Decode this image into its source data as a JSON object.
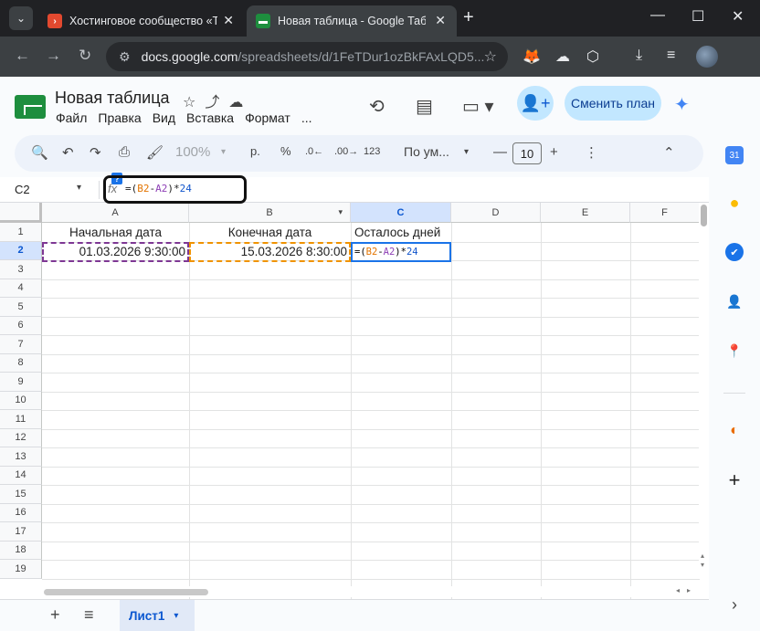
{
  "browser": {
    "tab_menu_glyph": "⌄",
    "tabs": [
      {
        "title": "Хостинговое сообщество «Tim",
        "favicon_color": "#e2492f",
        "favicon_glyph": "›",
        "close": "✕"
      },
      {
        "title": "Новая таблица - Google Табли",
        "favicon_color": "#1e8e3e",
        "favicon_glyph": "▬",
        "close": "✕"
      }
    ],
    "new_tab": "+",
    "window_controls": {
      "minimize": "—",
      "maximize": "☐",
      "close": "✕"
    },
    "nav": {
      "back": "←",
      "forward": "→",
      "reload": "↻",
      "site_info": "⚙"
    },
    "url_host": "docs.google.com",
    "url_path": "/spreadsheets/d/1FeTDur1ozBkFAxLQD5...",
    "bookmark": "☆",
    "extensions": [
      "🦊",
      "☁",
      "⬡",
      "⤓",
      "≡"
    ]
  },
  "doc": {
    "title": "Новая таблица",
    "title_icons": "☆⤴☁",
    "menu": [
      "Файл",
      "Правка",
      "Вид",
      "Вставка",
      "Формат",
      "..."
    ],
    "header_icons": {
      "history": "⟲",
      "comments": "▤",
      "meet": "▭ ▾"
    },
    "share_icon": "👤+",
    "plan_button": "Сменить план",
    "gemini": "✦"
  },
  "toolbar": {
    "search": "🔍",
    "undo": "↶",
    "redo": "↷",
    "print": "⎙",
    "paint_format": "🖌",
    "zoom": "100%",
    "zoom_caret": "▾",
    "currency": "р.",
    "percent": "%",
    "dec_decrease": ".0←",
    "dec_increase": ".00→",
    "format_123": "123",
    "font": "По ум...",
    "font_caret": "▾",
    "size_minus": "—",
    "font_size": "10",
    "size_plus": "+",
    "more": "⋮",
    "collapse": "⌃"
  },
  "formula_bar": {
    "name_box": "C2",
    "name_caret": "▾",
    "fx": "fx",
    "help_badge": "?",
    "formula_parts": [
      "=(",
      "B2",
      "-",
      "A2",
      ")*",
      "24"
    ]
  },
  "grid": {
    "columns": [
      "A",
      "B",
      "C",
      "D",
      "E",
      "F"
    ],
    "column_b_caret": "▾",
    "rows": [
      "1",
      "2",
      "3",
      "4",
      "5",
      "6",
      "7",
      "8",
      "9",
      "10",
      "11",
      "12",
      "13",
      "14",
      "15",
      "16",
      "17",
      "18",
      "19"
    ],
    "selected_column": "C",
    "selected_row": "2",
    "header_row": [
      "Начальная дата",
      "Конечная дата",
      "Осталось дней"
    ],
    "row2": {
      "a": "01.03.2026 9:30:00",
      "b": "15.03.2026 8:30:00"
    },
    "active_cell_parts": [
      "=(",
      "B2",
      "-",
      "A2",
      ")*",
      "24"
    ],
    "vscroll_arrows": [
      "▴",
      "▾"
    ],
    "hscroll_arrows": [
      "◂",
      "▸"
    ]
  },
  "sheets": {
    "add": "+",
    "list": "≡",
    "tabs": [
      "Лист1"
    ],
    "caret": "▾"
  },
  "side_panel": {
    "calendar": "31",
    "keep": "●",
    "tasks": "✔",
    "contacts": "👤",
    "maps": "📍",
    "office": "◐",
    "add": "+",
    "expand": "›"
  }
}
